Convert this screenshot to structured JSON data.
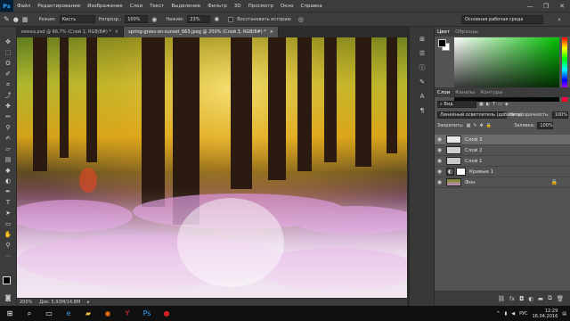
{
  "app": {
    "logo": "Ps"
  },
  "menubar": {
    "items": [
      "Файл",
      "Редактирование",
      "Изображение",
      "Слои",
      "Текст",
      "Выделение",
      "Фильтр",
      "3D",
      "Просмотр",
      "Окно",
      "Справка"
    ],
    "window_controls": [
      "—",
      "❐",
      "✕"
    ]
  },
  "options": {
    "mode_label": "Режим:",
    "mode_value": "Кисть",
    "opacity_label": "Непрозр.:",
    "opacity_value": "100%",
    "pressure_label": "Нажим:",
    "pressure_value": "23%",
    "restore_label": "Восстановить историю",
    "workspace": "Основная рабочая среда"
  },
  "doc_tabs": [
    "мокка.psd @ 66,7% (Слой 1, RGB/8#) *",
    "spring-grass-on-sunset_663.jpeg @ 200% (Слой 3, RGB/8#) *"
  ],
  "status": {
    "zoom": "200%",
    "doc_size": "Док: 5,93M/14,8M"
  },
  "panels": {
    "color_tabs": [
      "Цвет",
      "Образцы"
    ],
    "layers_tabs": [
      "Слои",
      "Каналы",
      "Контуры"
    ],
    "kind_label": "Вид",
    "blend_mode": "Линейный осветлитель (добавить)",
    "opacity_label": "Непрозрачность:",
    "opacity_value": "100%",
    "lock_label": "Закрепить:",
    "fill_label": "Заливка:",
    "fill_value": "100%",
    "layers": [
      {
        "name": "Слой 3",
        "selected": true
      },
      {
        "name": "Слой 2",
        "selected": false
      },
      {
        "name": "Слой 1",
        "selected": false
      },
      {
        "name": "Кривые 1",
        "selected": false
      },
      {
        "name": "Фон",
        "selected": false
      }
    ],
    "bottom_icons": [
      "link-icon",
      "fx-icon",
      "mask-icon",
      "adjustment-icon",
      "folder-icon",
      "new-layer-icon",
      "trash-icon"
    ]
  },
  "taskbar": {
    "time": "12:29",
    "date": "16.04.2016",
    "lang": "РУС"
  },
  "colors": {
    "accent": "#31a8ff",
    "ui_dark": "#3c3c3c",
    "ui_mid": "#535353",
    "selected_layer": "#6b6b6b"
  }
}
